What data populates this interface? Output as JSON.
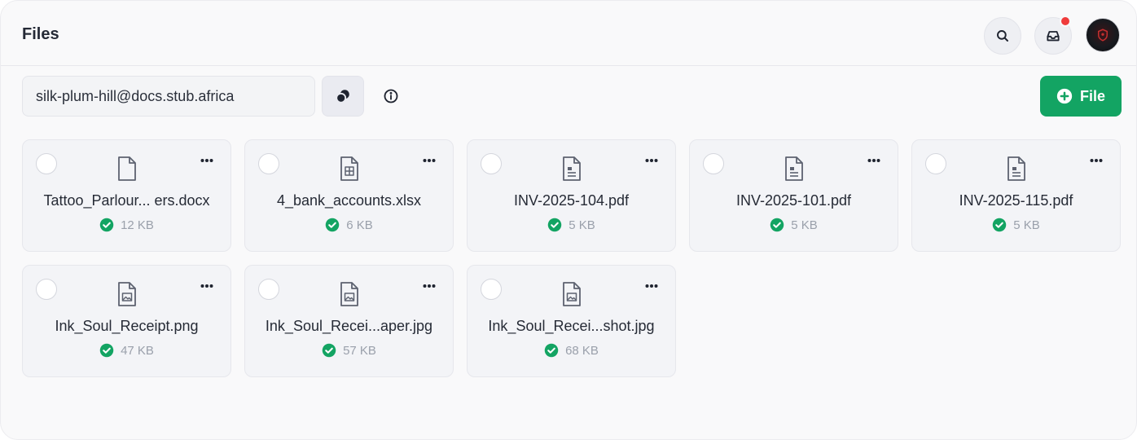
{
  "header": {
    "title": "Files"
  },
  "toolbar": {
    "email": "silk-plum-hill@docs.stub.africa",
    "add_label": "File"
  },
  "icons": {
    "search": "search-icon",
    "inbox": "inbox-icon",
    "copy": "copy-icon",
    "info": "info-icon",
    "add": "plus-circle-icon",
    "status": "check-circle-icon",
    "menu": "more-horizontal-icon"
  },
  "colors": {
    "accent": "#13a463",
    "notification": "#ef3b3b",
    "status_ok": "#13a463"
  },
  "files": [
    {
      "name": "Tattoo_Parlour... ers.docx",
      "size": "12 KB",
      "icon": "document-icon"
    },
    {
      "name": "4_bank_accounts.xlsx",
      "size": "6 KB",
      "icon": "spreadsheet-icon"
    },
    {
      "name": "INV-2025-104.pdf",
      "size": "5 KB",
      "icon": "pdf-icon"
    },
    {
      "name": "INV-2025-101.pdf",
      "size": "5 KB",
      "icon": "pdf-icon"
    },
    {
      "name": "INV-2025-115.pdf",
      "size": "5 KB",
      "icon": "pdf-icon"
    },
    {
      "name": "Ink_Soul_Receipt.png",
      "size": "47 KB",
      "icon": "image-icon"
    },
    {
      "name": "Ink_Soul_Recei...aper.jpg",
      "size": "57 KB",
      "icon": "image-icon"
    },
    {
      "name": "Ink_Soul_Recei...shot.jpg",
      "size": "68 KB",
      "icon": "image-icon"
    }
  ]
}
